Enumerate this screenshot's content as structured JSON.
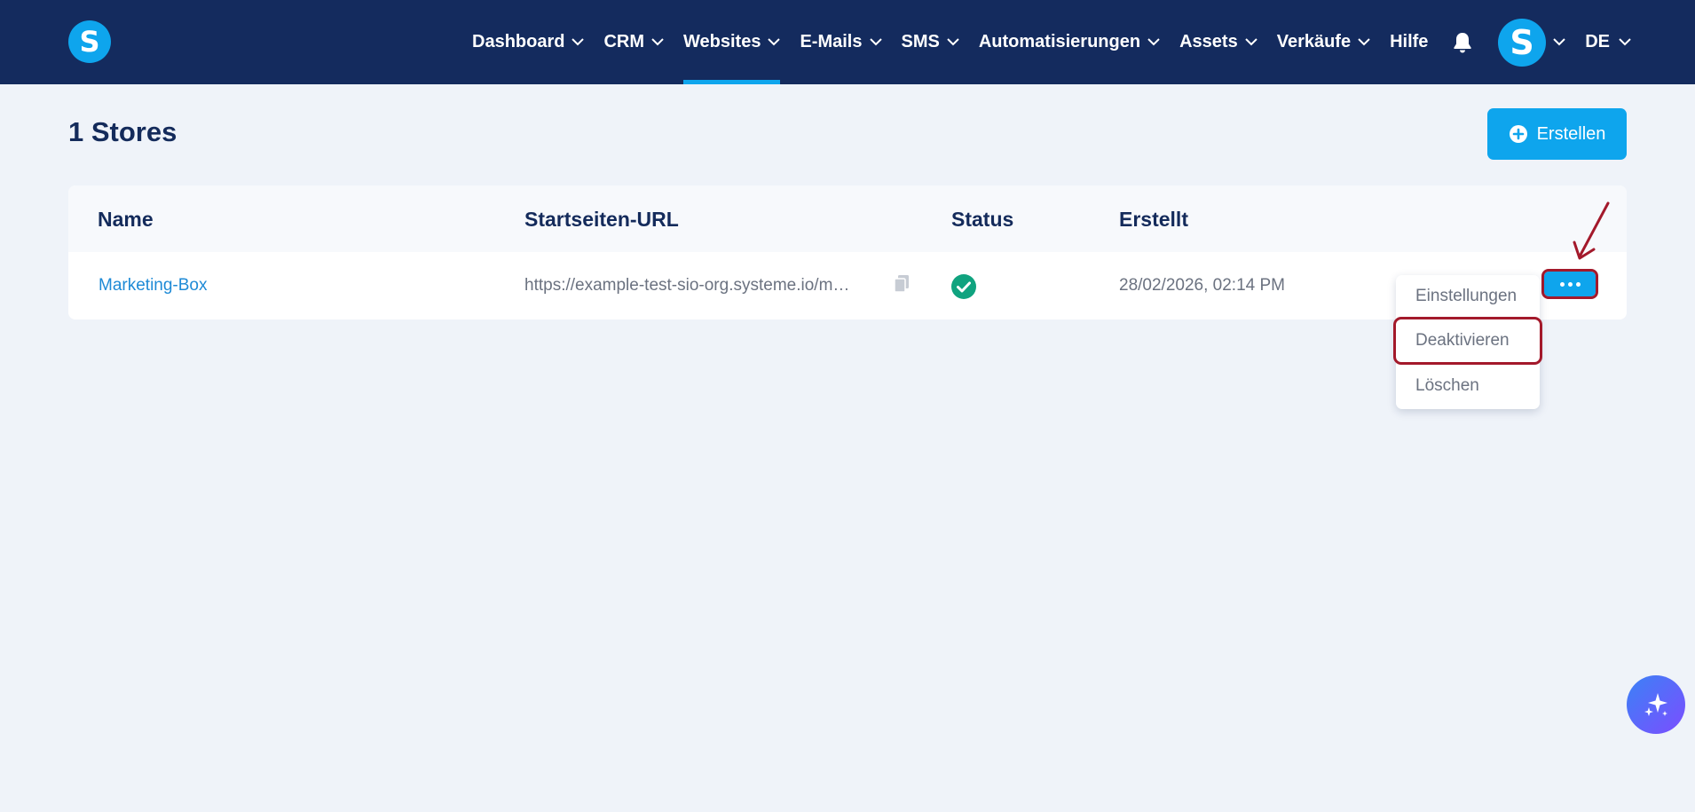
{
  "app": {
    "logo_letter": "S",
    "accent": "#0ea5ed",
    "nav_bg": "#142b5e"
  },
  "nav": {
    "items": [
      {
        "label": "Dashboard",
        "has_dropdown": true,
        "active": false
      },
      {
        "label": "CRM",
        "has_dropdown": true,
        "active": false
      },
      {
        "label": "Websites",
        "has_dropdown": true,
        "active": true
      },
      {
        "label": "E-Mails",
        "has_dropdown": true,
        "active": false
      },
      {
        "label": "SMS",
        "has_dropdown": true,
        "active": false
      },
      {
        "label": "Automatisierungen",
        "has_dropdown": true,
        "active": false
      },
      {
        "label": "Assets",
        "has_dropdown": true,
        "active": false
      },
      {
        "label": "Verkäufe",
        "has_dropdown": true,
        "active": false
      },
      {
        "label": "Hilfe",
        "has_dropdown": false,
        "active": false
      }
    ],
    "avatar_letter": "S",
    "language": "DE",
    "icons": {
      "notifications": "bell-icon"
    }
  },
  "page": {
    "title": "1 Stores",
    "create_button": "Erstellen"
  },
  "table": {
    "headers": {
      "name": "Name",
      "url": "Startseiten-URL",
      "status": "Status",
      "created": "Erstellt"
    },
    "rows": [
      {
        "name": "Marketing-Box",
        "url": "https://example-test-sio-org.systeme.io/m…",
        "status": "active",
        "created": "28/02/2026, 02:14 PM"
      }
    ]
  },
  "row_menu": {
    "items": [
      "Einstellungen",
      "Deaktivieren",
      "Löschen"
    ],
    "highlighted": "Deaktivieren"
  },
  "annotation_color": "#a3192b"
}
